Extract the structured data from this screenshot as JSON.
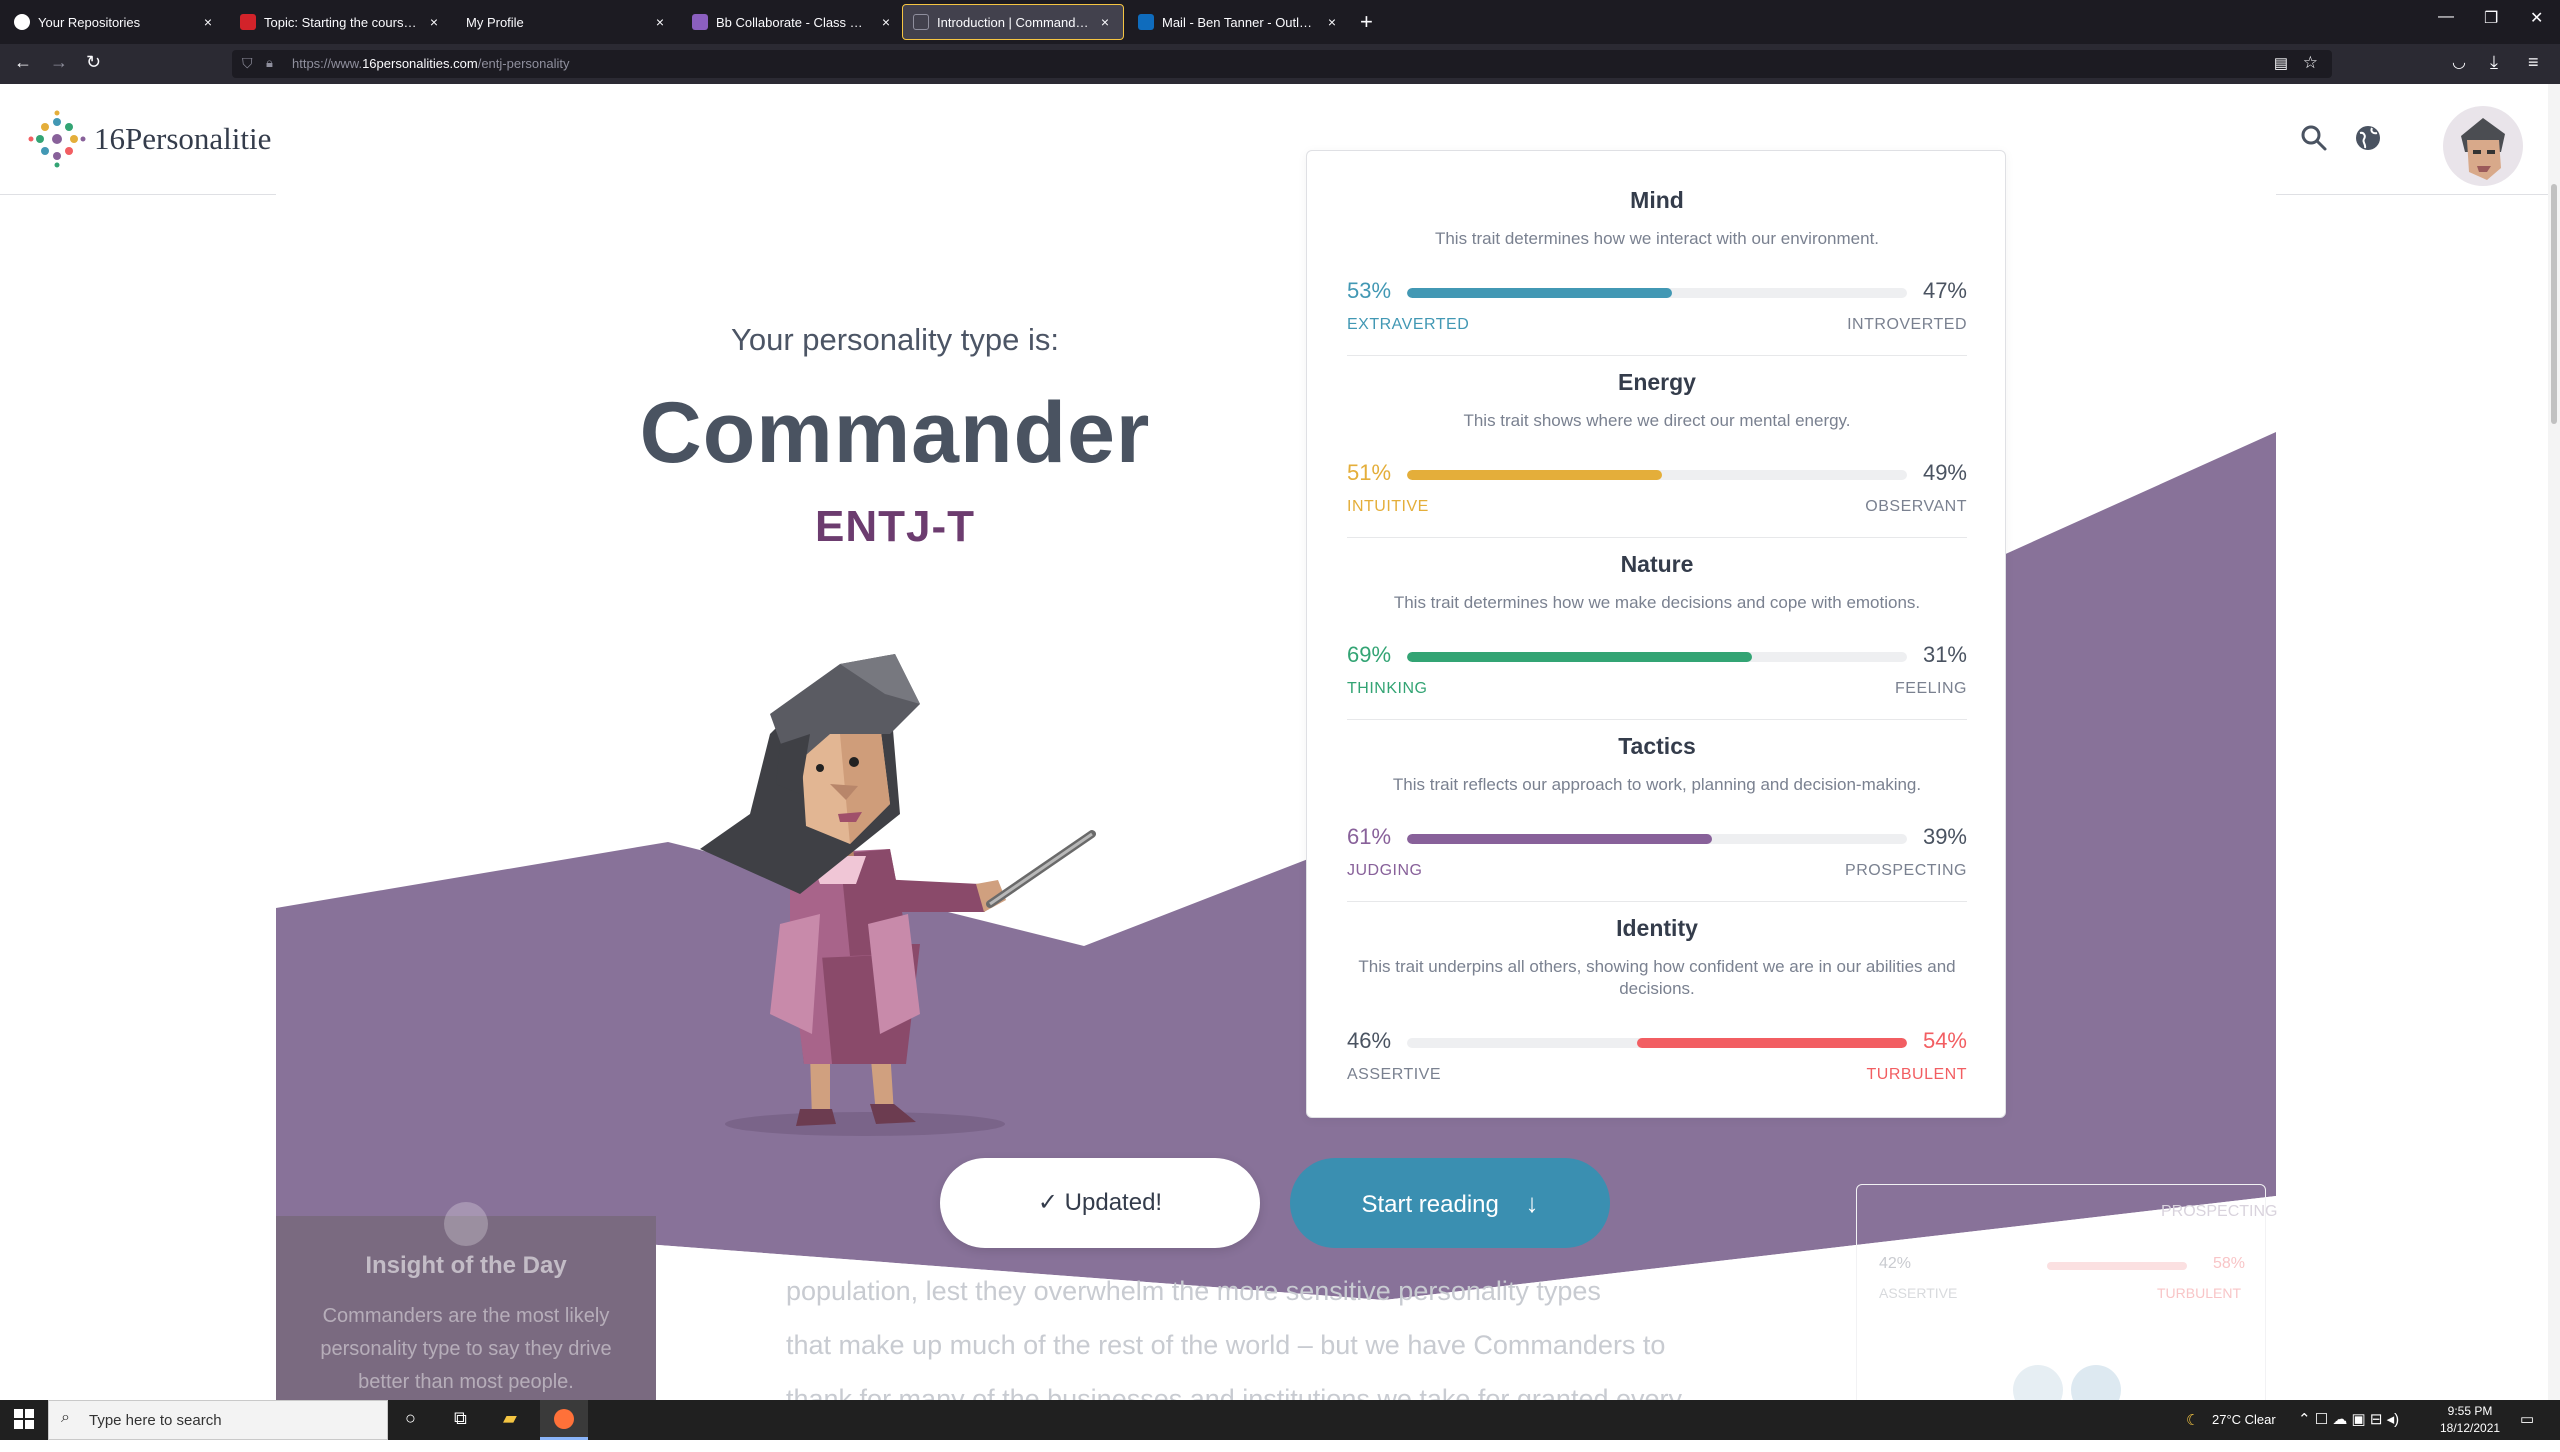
{
  "browser": {
    "tabs": [
      {
        "label": "Your Repositories",
        "active": false
      },
      {
        "label": "Topic: Starting the course, Assig",
        "active": false
      },
      {
        "label": "My Profile",
        "active": false
      },
      {
        "label": "Bb Collaborate - Class B - Web",
        "active": false
      },
      {
        "label": "Introduction | Commander (EN",
        "active": true
      },
      {
        "label": "Mail - Ben Tanner - Outlook",
        "active": false
      }
    ],
    "url_prefix": "https://www.",
    "url_domain": "16personalities.com",
    "url_path": "/entj-personality"
  },
  "site": {
    "logo_text": "16Personalitie"
  },
  "hero": {
    "intro": "Your personality type is:",
    "type_name": "Commander",
    "type_code": "ENTJ-T"
  },
  "traits": [
    {
      "name": "Mind",
      "description": "This trait determines how we interact with our environment.",
      "left_pct": "53%",
      "right_pct": "47%",
      "left_label": "EXTRAVERTED",
      "right_label": "INTROVERTED",
      "dominant": "left",
      "value": 0.53,
      "color": "#4298b4"
    },
    {
      "name": "Energy",
      "description": "This trait shows where we direct our mental energy.",
      "left_pct": "51%",
      "right_pct": "49%",
      "left_label": "INTUITIVE",
      "right_label": "OBSERVANT",
      "dominant": "left",
      "value": 0.51,
      "color": "#e4ae3a"
    },
    {
      "name": "Nature",
      "description": "This trait determines how we make decisions and cope with emotions.",
      "left_pct": "69%",
      "right_pct": "31%",
      "left_label": "THINKING",
      "right_label": "FEELING",
      "dominant": "left",
      "value": 0.69,
      "color": "#33a474"
    },
    {
      "name": "Tactics",
      "description": "This trait reflects our approach to work, planning and decision-making.",
      "left_pct": "61%",
      "right_pct": "39%",
      "left_label": "JUDGING",
      "right_label": "PROSPECTING",
      "dominant": "left",
      "value": 0.61,
      "color": "#88619a"
    },
    {
      "name": "Identity",
      "description": "This trait underpins all others, showing how confident we are in our abilities and decisions.",
      "left_pct": "46%",
      "right_pct": "54%",
      "left_label": "ASSERTIVE",
      "right_label": "TURBULENT",
      "dominant": "right",
      "value": 0.54,
      "color": "#f25e62"
    }
  ],
  "buttons": {
    "updated": "✓ Updated!",
    "start_reading": "Start reading",
    "start_reading_icon": "↓"
  },
  "insight": {
    "title": "Insight of the Day",
    "text": "Commanders are the most likely personality type to say they drive better than most people."
  },
  "article": {
    "lines": [
      "population, lest they overwhelm the more sensitive personality types",
      "that make up much of the rest of the world – but we have Commanders to",
      "thank for many of the businesses and institutions we take for granted every"
    ]
  },
  "ghost_panel": {
    "prospecting": "PROSPECTING",
    "left_pct": "42%",
    "right_pct": "58%",
    "assertive": "ASSERTIVE",
    "turbulent": "TURBULENT"
  },
  "taskbar": {
    "search_placeholder": "Type here to search",
    "weather": "27°C  Clear",
    "time": "9:55 PM",
    "date": "18/12/2021"
  }
}
